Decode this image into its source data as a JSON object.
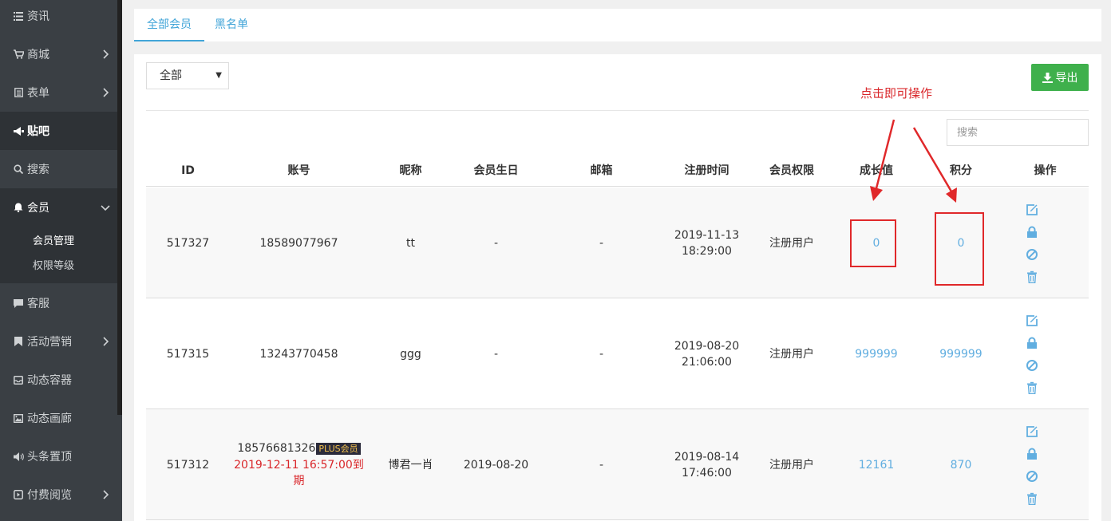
{
  "sidebar": {
    "items": [
      {
        "label": "资讯",
        "icon": "list-icon"
      },
      {
        "label": "商城",
        "icon": "cart-icon"
      },
      {
        "label": "表单",
        "icon": "form-icon"
      },
      {
        "label": "贴吧",
        "icon": "megaphone-icon"
      },
      {
        "label": "搜索",
        "icon": "search-icon"
      },
      {
        "label": "会员",
        "icon": "bell-icon"
      },
      {
        "label": "客服",
        "icon": "chat-icon"
      },
      {
        "label": "活动营销",
        "icon": "bookmark-icon"
      },
      {
        "label": "动态容器",
        "icon": "inbox-icon"
      },
      {
        "label": "动态画廊",
        "icon": "picture-icon"
      },
      {
        "label": "头条置顶",
        "icon": "volume-icon"
      },
      {
        "label": "付费阅览",
        "icon": "play-icon"
      }
    ],
    "submenu": [
      "会员管理",
      "权限等级"
    ]
  },
  "tabs": [
    "全部会员",
    "黑名单"
  ],
  "filter": {
    "selected": "全部"
  },
  "export_label": "导出",
  "search_placeholder": "搜索",
  "annotation": "点击即可操作",
  "table": {
    "headers": [
      "ID",
      "账号",
      "昵称",
      "会员生日",
      "邮箱",
      "注册时间",
      "会员权限",
      "成长值",
      "积分",
      "操作"
    ],
    "rows": [
      {
        "id": "517327",
        "account": "18589077967",
        "nickname": "tt",
        "birthday": "-",
        "email": "-",
        "reg_date": "2019-11-13",
        "reg_time": "18:29:00",
        "role": "注册用户",
        "growth": "0",
        "points": "0"
      },
      {
        "id": "517315",
        "account": "13243770458",
        "nickname": "ggg",
        "birthday": "-",
        "email": "-",
        "reg_date": "2019-08-20",
        "reg_time": "21:06:00",
        "role": "注册用户",
        "growth": "999999",
        "points": "999999"
      },
      {
        "id": "517312",
        "account": "18576681326",
        "plus_badge": "PLUS会员",
        "expire_line1": "2019-12-11 16:57:00到",
        "expire_line2": "期",
        "nickname": "博君一肖",
        "birthday": "2019-08-20",
        "email": "-",
        "reg_date": "2019-08-14",
        "reg_time": "17:46:00",
        "role": "注册用户",
        "growth": "12161",
        "points": "870"
      }
    ]
  }
}
